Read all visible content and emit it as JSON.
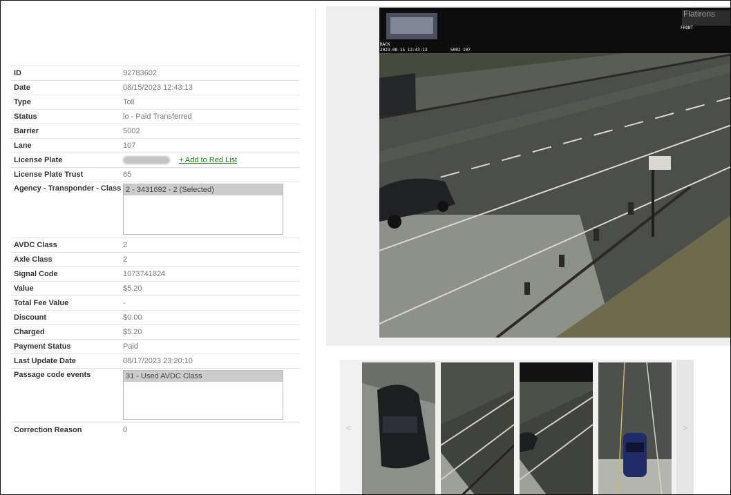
{
  "details": {
    "rows": [
      {
        "label": "ID",
        "value": "92783602"
      },
      {
        "label": "Date",
        "value": "08/15/2023 12:43:13"
      },
      {
        "label": "Type",
        "value": "Toll"
      },
      {
        "label": "Status",
        "value": "lo - Paid Transferred"
      },
      {
        "label": "Barrier",
        "value": "5002"
      },
      {
        "label": "Lane",
        "value": "107"
      }
    ],
    "license_plate_label": "License Plate",
    "add_red_list": "+ Add to Red List",
    "plate_trust_label": "License Plate Trust",
    "plate_trust_value": "65",
    "agency_label": "Agency - Transponder - Class",
    "agency_option": "2 - 3431692 - 2 (Selected)",
    "rows2": [
      {
        "label": "AVDC Class",
        "value": "2"
      },
      {
        "label": "Axle Class",
        "value": "2"
      },
      {
        "label": "Signal Code",
        "value": "1073741824"
      },
      {
        "label": "Value",
        "value": "$5.20"
      },
      {
        "label": "Total Fee Value",
        "value": "-"
      },
      {
        "label": "Discount",
        "value": "$0.00"
      },
      {
        "label": "Charged",
        "value": "$5.20"
      },
      {
        "label": "Payment Status",
        "value": "Paid"
      },
      {
        "label": "Last Update Date",
        "value": "08/17/2023 23:20:10"
      }
    ],
    "passage_label": "Passage code events",
    "passage_option": "31 - Used AVDC Class",
    "correction_label": "Correction Reason",
    "correction_value": "0"
  },
  "camera": {
    "back_label": "BACK",
    "timestamp": "2023-08-15 12:43:13",
    "lane_code": "5002 107",
    "brand": "Flatirons",
    "front_label": "FRONT"
  },
  "thumbs": {
    "prev": "<",
    "next": ">"
  }
}
